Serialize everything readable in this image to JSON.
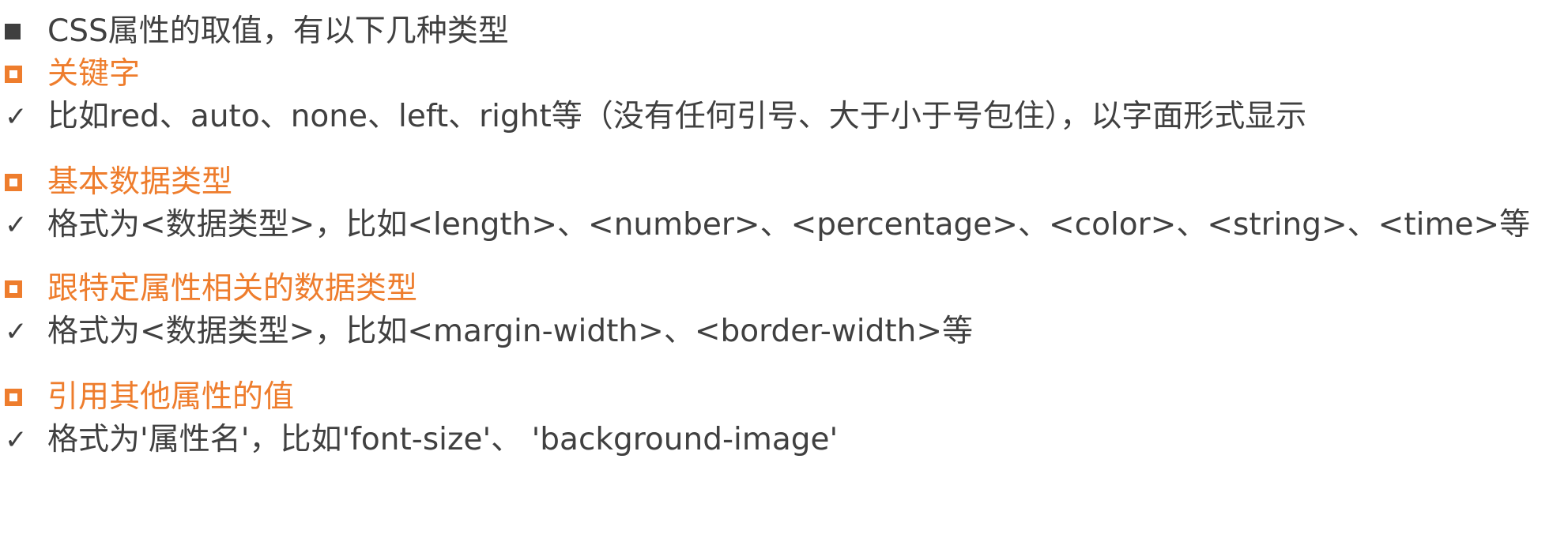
{
  "intro": {
    "text": "CSS属性的取值，有以下几种类型"
  },
  "sections": [
    {
      "heading": "关键字",
      "detail": "比如red、auto、none、left、right等（没有任何引号、大于小于号包住），以字面形式显示"
    },
    {
      "heading": "基本数据类型",
      "detail": "格式为<数据类型>，比如<length>、<number>、<percentage>、<color>、<string>、<time>等"
    },
    {
      "heading": "跟特定属性相关的数据类型",
      "detail": "格式为<数据类型>，比如<margin-width>、<border-width>等"
    },
    {
      "heading": "引用其他属性的值",
      "detail": "格式为'属性名'，比如'font-size'、 'background-image'"
    }
  ],
  "icons": {
    "intro_bullet": "filled-square-icon",
    "heading_bullet": "hollow-square-icon",
    "detail_bullet": "checkmark-icon"
  },
  "colors": {
    "text": "#404040",
    "accent": "#ee7d2d"
  }
}
